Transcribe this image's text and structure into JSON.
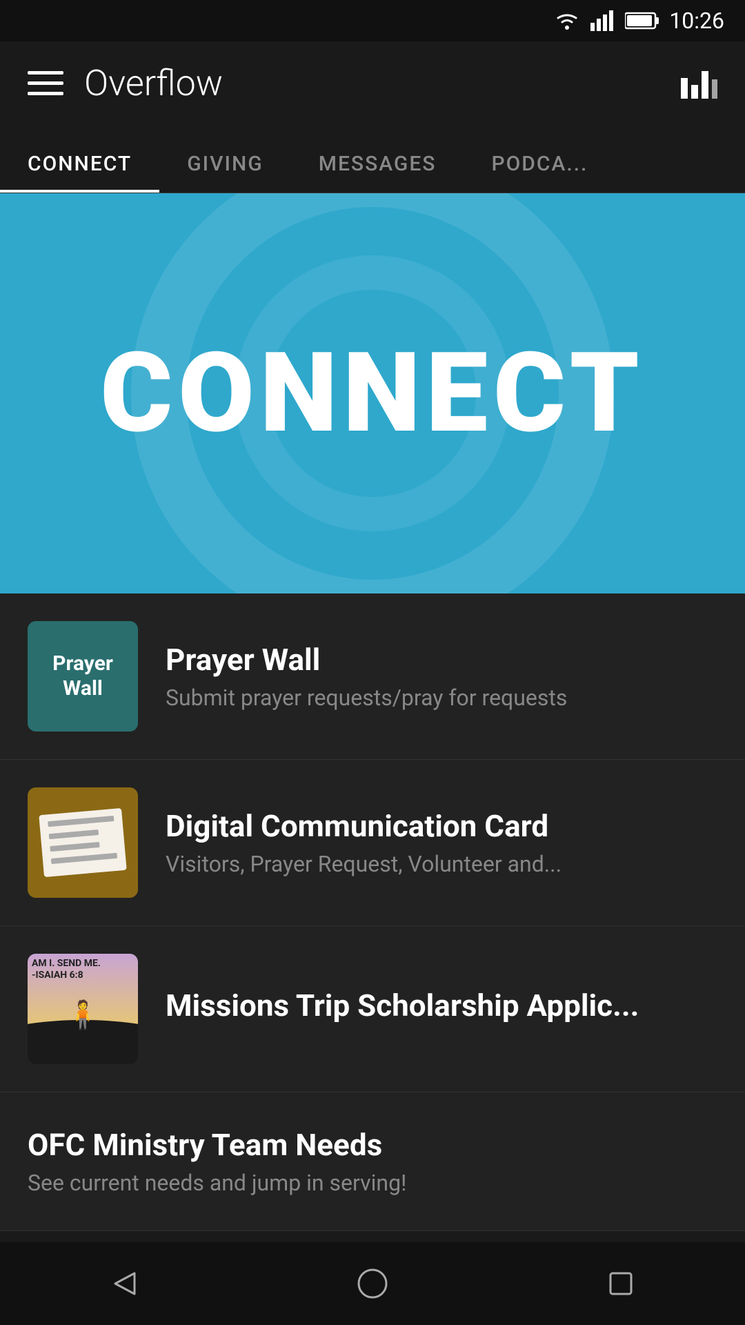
{
  "statusBar": {
    "time": "10:26"
  },
  "header": {
    "title": "Overflow",
    "menuIcon": "menu-icon",
    "chartIcon": "bar-chart-icon"
  },
  "tabs": [
    {
      "id": "connect",
      "label": "CONNECT",
      "active": true
    },
    {
      "id": "giving",
      "label": "GIVING",
      "active": false
    },
    {
      "id": "messages",
      "label": "MESSAGES",
      "active": false
    },
    {
      "id": "podcast",
      "label": "PODCA...",
      "active": false
    }
  ],
  "hero": {
    "text": "CONNECT"
  },
  "listItems": [
    {
      "id": "prayer-wall",
      "title": "Prayer Wall",
      "subtitle": "Submit prayer requests/pray for requests",
      "thumbType": "prayer-wall",
      "thumbText1": "Prayer",
      "thumbText2": "Wall"
    },
    {
      "id": "digital-card",
      "title": "Digital Communication Card",
      "subtitle": "Visitors, Prayer Request, Volunteer and...",
      "thumbType": "digital-card"
    },
    {
      "id": "missions",
      "title": "Missions Trip Scholarship Applic...",
      "subtitle": "",
      "thumbType": "missions",
      "thumbOverlay": "AM I. SEND ME. -ISAIAH 6:8"
    }
  ],
  "ministryItem": {
    "title": "OFC Ministry Team Needs",
    "subtitle": "See current needs and jump in serving!"
  },
  "bottomNav": {
    "back": "back-icon",
    "home": "home-icon",
    "recent": "recent-apps-icon"
  }
}
